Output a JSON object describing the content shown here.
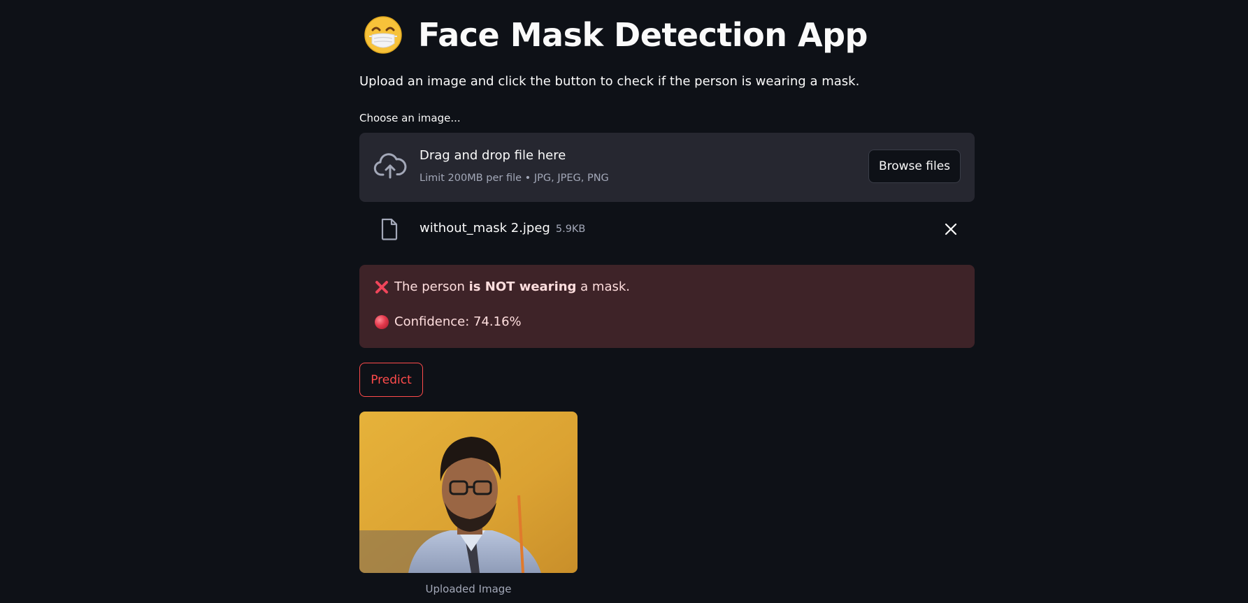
{
  "header": {
    "title": "Face Mask Detection App",
    "title_icon": "face-with-medical-mask-emoji"
  },
  "intro": "Upload an image and click the button to check if the person is wearing a mask.",
  "uploader": {
    "label": "Choose an image...",
    "drop_title": "Drag and drop file here",
    "limit_text": "Limit 200MB per file • JPG, JPEG, PNG",
    "browse_label": "Browse files",
    "icon": "cloud-upload-icon"
  },
  "uploaded_file": {
    "name": "without_mask 2.jpeg",
    "size": "5.9KB",
    "icon": "file-icon",
    "remove_icon": "close-icon"
  },
  "result": {
    "prefix": "The person",
    "emphasis": "is NOT wearing",
    "suffix": "a mask.",
    "confidence": "Confidence: 74.16%",
    "status_icon": "cross-mark-icon",
    "confidence_icon": "red-circle-icon"
  },
  "predict_label": "Predict",
  "image_caption": "Uploaded Image",
  "colors": {
    "background": "#0e1117",
    "surface": "#262730",
    "error_bg": "#3e2328",
    "accent": "#ff4b4b"
  }
}
